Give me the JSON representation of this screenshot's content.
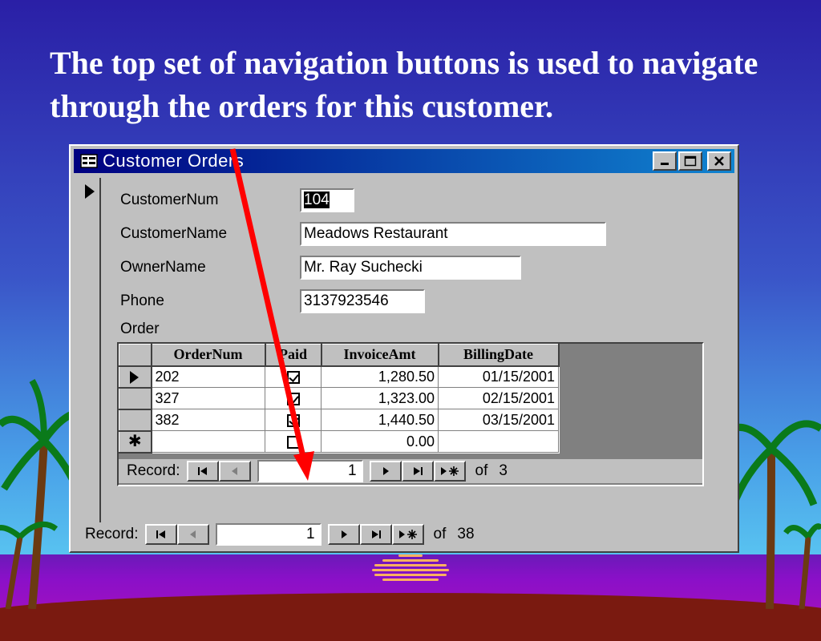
{
  "slide": {
    "title": "The top set of navigation buttons is used to navigate through the orders for this customer."
  },
  "window": {
    "title": "Customer Orders",
    "controls": {
      "minimize": "minimize-icon",
      "maximize": "maximize-icon",
      "close": "close-icon"
    }
  },
  "form": {
    "fields": [
      {
        "label": "CustomerNum",
        "value": "104"
      },
      {
        "label": "CustomerName",
        "value": "Meadows Restaurant"
      },
      {
        "label": "OwnerName",
        "value": "Mr. Ray Suchecki"
      },
      {
        "label": "Phone",
        "value": "3137923546"
      }
    ],
    "subform_label": "Order"
  },
  "orders": {
    "columns": [
      "OrderNum",
      "Paid",
      "InvoiceAmt",
      "BillingDate"
    ],
    "rows": [
      {
        "ordernum": "202",
        "paid": true,
        "invoice": "1,280.50",
        "date": "01/15/2001"
      },
      {
        "ordernum": "327",
        "paid": true,
        "invoice": "1,323.00",
        "date": "02/15/2001"
      },
      {
        "ordernum": "382",
        "paid": true,
        "invoice": "1,440.50",
        "date": "03/15/2001"
      }
    ],
    "new_row": {
      "invoice": "0.00"
    },
    "new_row_marker": "✱"
  },
  "subform_nav": {
    "label": "Record:",
    "current": "1",
    "of_label": "of",
    "total": "3"
  },
  "main_nav": {
    "label": "Record:",
    "current": "1",
    "of_label": "of",
    "total": "38"
  },
  "colors": {
    "arrow": "#ff0000",
    "titlebar": "#000080",
    "face": "#c0c0c0"
  }
}
